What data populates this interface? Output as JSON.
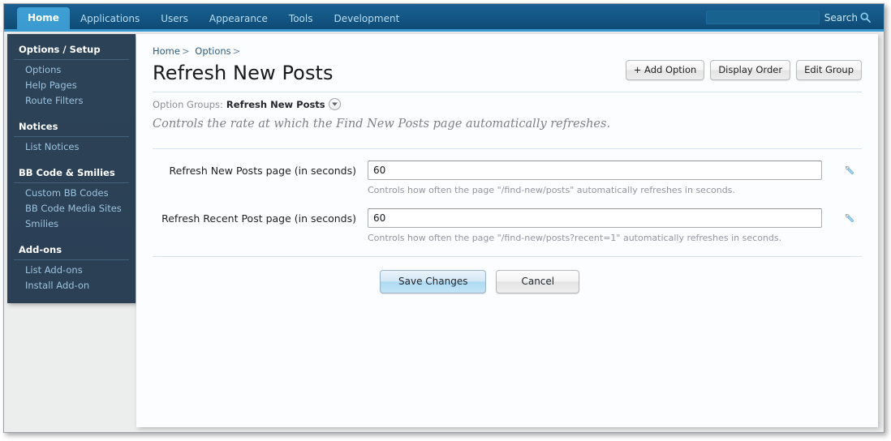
{
  "topnav": {
    "tabs": [
      {
        "label": "Home",
        "active": true
      },
      {
        "label": "Applications",
        "active": false
      },
      {
        "label": "Users",
        "active": false
      },
      {
        "label": "Appearance",
        "active": false
      },
      {
        "label": "Tools",
        "active": false
      },
      {
        "label": "Development",
        "active": false
      }
    ],
    "search": {
      "label": "Search",
      "value": "",
      "placeholder": "",
      "icon": "search-icon"
    }
  },
  "sidebar": {
    "groups": [
      {
        "title": "Options / Setup",
        "items": [
          {
            "label": "Options"
          },
          {
            "label": "Help Pages"
          },
          {
            "label": "Route Filters"
          }
        ]
      },
      {
        "title": "Notices",
        "items": [
          {
            "label": "List Notices"
          }
        ]
      },
      {
        "title": "BB Code & Smilies",
        "items": [
          {
            "label": "Custom BB Codes"
          },
          {
            "label": "BB Code Media Sites"
          },
          {
            "label": "Smilies"
          }
        ]
      },
      {
        "title": "Add-ons",
        "items": [
          {
            "label": "List Add-ons"
          },
          {
            "label": "Install Add-on"
          }
        ]
      }
    ]
  },
  "main": {
    "breadcrumb": [
      {
        "label": "Home",
        "sep": ">"
      },
      {
        "label": "Options",
        "sep": ">"
      }
    ],
    "page_title": "Refresh New Posts",
    "actions": [
      {
        "label": "+ Add Option",
        "name": "add-option-button"
      },
      {
        "label": "Display Order",
        "name": "display-order-button"
      },
      {
        "label": "Edit Group",
        "name": "edit-group-button"
      }
    ],
    "option_groups": {
      "label": "Option Groups:",
      "value": "Refresh New Posts",
      "dropdown_icon": "chevron-down-icon"
    },
    "description": "Controls the rate at which the Find New Posts page automatically refreshes.",
    "fields": [
      {
        "label": "Refresh New Posts page (in seconds)",
        "value": "60",
        "placeholder": "",
        "hint": "Controls how often the page \"/find-new/posts\" automatically refreshes in seconds.",
        "tool_icon": "wrench-icon"
      },
      {
        "label": "Refresh Recent Post page (in seconds)",
        "value": "60",
        "placeholder": "",
        "hint": "Controls how often the page \"/find-new/posts?recent=1\" automatically refreshes in seconds.",
        "tool_icon": "wrench-icon"
      }
    ],
    "submit": {
      "save_label": "Save Changes",
      "cancel_label": "Cancel"
    }
  },
  "colors": {
    "topbar_dark": "#145886",
    "topbar_accent": "#3a9ad0",
    "sidebar_bg": "#2c4257",
    "sidebar_link": "#9cc3de",
    "panel_bg": "#fcfdfe",
    "divider": "#d7e4f0",
    "hint_text": "#9296a0",
    "wrench_blue": "#a8d4ee"
  }
}
